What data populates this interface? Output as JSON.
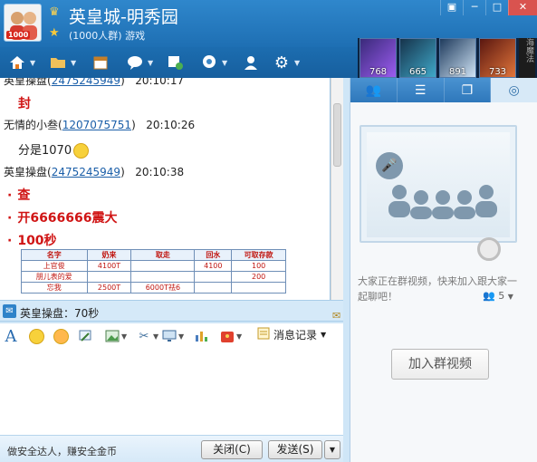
{
  "window": {
    "group_name": "英皇城-明秀园",
    "group_subtitle": "(1000人群) 游戏",
    "avatar_badge": "1000",
    "controls": [
      "▣",
      "─",
      "□",
      "✕"
    ]
  },
  "toolbar": {
    "icons": [
      "home-icon",
      "folder-icon",
      "calendar-icon",
      "chat-bubble-icon",
      "add-note-icon",
      "webcam-icon",
      "agent-icon",
      "gear-icon"
    ]
  },
  "games": {
    "scores": [
      "768",
      "665",
      "891",
      "733"
    ],
    "extra_label": "海魔法"
  },
  "chat": {
    "messages": [
      {
        "sender": "英皇操盘",
        "uid": "2475245949",
        "time": "20:10:17"
      },
      {
        "text": "封"
      },
      {
        "sender": "无情的小叁",
        "uid": "1207075751",
        "time": "20:10:26"
      },
      {
        "text": "分是1070"
      },
      {
        "sender": "英皇操盘",
        "uid": "2475245949",
        "time": "20:10:38"
      },
      {
        "text": "查"
      },
      {
        "text": "开6666666震大"
      },
      {
        "text": "100秒"
      }
    ],
    "table": {
      "headers": [
        "名字",
        "奶来",
        "取走",
        "回水",
        "可取存款"
      ],
      "rows": [
        [
          "上官俊",
          "4100T",
          "",
          "4100",
          "100"
        ],
        [
          "朋儿表的爱",
          "",
          "",
          "",
          "200"
        ],
        [
          "忘我",
          "2500T",
          "6000T祛6",
          "",
          ""
        ],
        [
          "",
          "",
          "",
          "",
          ""
        ]
      ]
    }
  },
  "notice": {
    "text": "英皇操盘：70秒"
  },
  "input_toolbar": {
    "history_label": "消息记录"
  },
  "bottom": {
    "safety_text": "做安全达人，赚安全金币",
    "close_label": "关闭(C)",
    "send_label": "发送(S)"
  },
  "video_panel": {
    "description": "大家正在群视频，快来加入跟大家一起聊吧！",
    "member_count": "5",
    "join_label": "加入群视频"
  }
}
